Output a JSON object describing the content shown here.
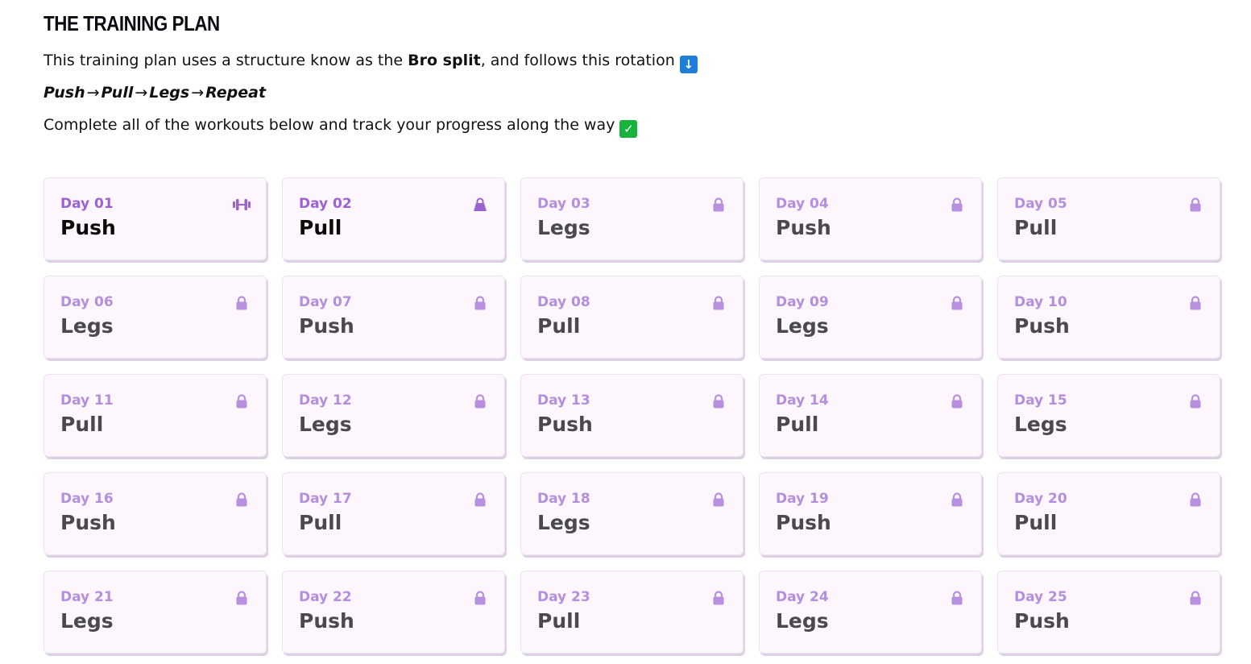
{
  "heading": "THE TRAINING PLAN",
  "intro": {
    "prefix": "This training plan uses a structure know as the ",
    "bold": "Bro split",
    "suffix": ", and follows this rotation",
    "emoji": "↓"
  },
  "rotation": {
    "steps": [
      "Push",
      "Pull",
      "Legs",
      "Repeat"
    ],
    "arrow": "→"
  },
  "complete": {
    "text": "Complete all of the workouts below and track your progress along the way",
    "emoji": "✓"
  },
  "colors": {
    "accent": "#9a63d0",
    "locked_label": "#b38fdc",
    "card_bg": "#fdf6fd"
  },
  "days": [
    {
      "day": "Day 01",
      "workout": "Push",
      "status": "current",
      "icon": "dumbbell-icon"
    },
    {
      "day": "Day 02",
      "workout": "Pull",
      "status": "unlocked",
      "icon": "kettlebell-icon"
    },
    {
      "day": "Day 03",
      "workout": "Legs",
      "status": "locked",
      "icon": "lock-icon"
    },
    {
      "day": "Day 04",
      "workout": "Push",
      "status": "locked",
      "icon": "lock-icon"
    },
    {
      "day": "Day 05",
      "workout": "Pull",
      "status": "locked",
      "icon": "lock-icon"
    },
    {
      "day": "Day 06",
      "workout": "Legs",
      "status": "locked",
      "icon": "lock-icon"
    },
    {
      "day": "Day 07",
      "workout": "Push",
      "status": "locked",
      "icon": "lock-icon"
    },
    {
      "day": "Day 08",
      "workout": "Pull",
      "status": "locked",
      "icon": "lock-icon"
    },
    {
      "day": "Day 09",
      "workout": "Legs",
      "status": "locked",
      "icon": "lock-icon"
    },
    {
      "day": "Day 10",
      "workout": "Push",
      "status": "locked",
      "icon": "lock-icon"
    },
    {
      "day": "Day 11",
      "workout": "Pull",
      "status": "locked",
      "icon": "lock-icon"
    },
    {
      "day": "Day 12",
      "workout": "Legs",
      "status": "locked",
      "icon": "lock-icon"
    },
    {
      "day": "Day 13",
      "workout": "Push",
      "status": "locked",
      "icon": "lock-icon"
    },
    {
      "day": "Day 14",
      "workout": "Pull",
      "status": "locked",
      "icon": "lock-icon"
    },
    {
      "day": "Day 15",
      "workout": "Legs",
      "status": "locked",
      "icon": "lock-icon"
    },
    {
      "day": "Day 16",
      "workout": "Push",
      "status": "locked",
      "icon": "lock-icon"
    },
    {
      "day": "Day 17",
      "workout": "Pull",
      "status": "locked",
      "icon": "lock-icon"
    },
    {
      "day": "Day 18",
      "workout": "Legs",
      "status": "locked",
      "icon": "lock-icon"
    },
    {
      "day": "Day 19",
      "workout": "Push",
      "status": "locked",
      "icon": "lock-icon"
    },
    {
      "day": "Day 20",
      "workout": "Pull",
      "status": "locked",
      "icon": "lock-icon"
    },
    {
      "day": "Day 21",
      "workout": "Legs",
      "status": "locked",
      "icon": "lock-icon"
    },
    {
      "day": "Day 22",
      "workout": "Push",
      "status": "locked",
      "icon": "lock-icon"
    },
    {
      "day": "Day 23",
      "workout": "Pull",
      "status": "locked",
      "icon": "lock-icon"
    },
    {
      "day": "Day 24",
      "workout": "Legs",
      "status": "locked",
      "icon": "lock-icon"
    },
    {
      "day": "Day 25",
      "workout": "Push",
      "status": "locked",
      "icon": "lock-icon"
    }
  ]
}
